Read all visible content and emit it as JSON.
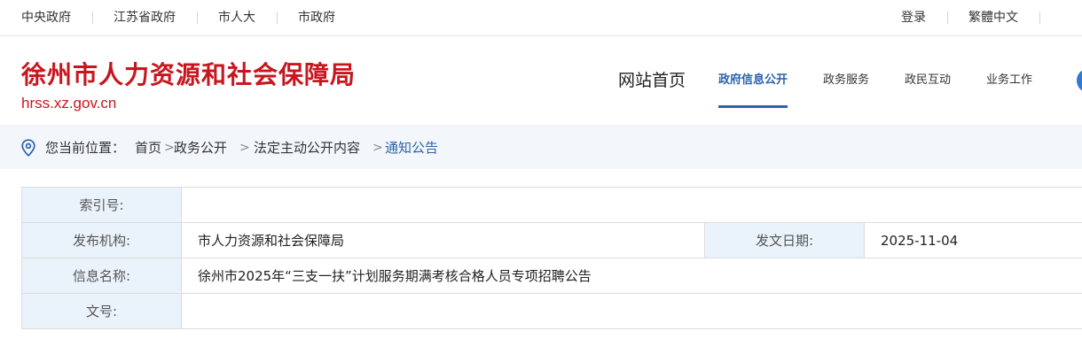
{
  "topbar": {
    "links": [
      "中央政府",
      "江苏省政府",
      "市人大",
      "市政府"
    ],
    "login": "登录",
    "language": "繁體中文"
  },
  "header": {
    "site_name": "徐州市人力资源和社会保障局",
    "site_domain": "hrss.xz.gov.cn",
    "nav": {
      "home": "网站首页",
      "items": [
        "政府信息公开",
        "政务服务",
        "政民互动",
        "业务工作"
      ],
      "active_index": 0
    }
  },
  "breadcrumb": {
    "label": "您当前位置：",
    "items": [
      "首页",
      "政务公开",
      "法定主动公开内容",
      "通知公告"
    ],
    "separator": ">"
  },
  "info": {
    "index_label": "索引号:",
    "index_value": "",
    "publisher_label": "发布机构:",
    "publisher_value": "市人力资源和社会保障局",
    "date_label": "发文日期:",
    "date_value": "2025-11-04",
    "name_label": "信息名称:",
    "name_value": "徐州市2025年“三支一扶”计划服务期满考核合格人员专项招聘公告",
    "doc_no_label": "文号:",
    "doc_no_value": ""
  },
  "colors": {
    "brand_red": "#c8161e",
    "accent_blue": "#2a63ad",
    "label_bg": "#eaf2fb",
    "crumb_bg": "#f3f7fb"
  },
  "icons": [
    "location-pin-icon",
    "user-icon"
  ]
}
